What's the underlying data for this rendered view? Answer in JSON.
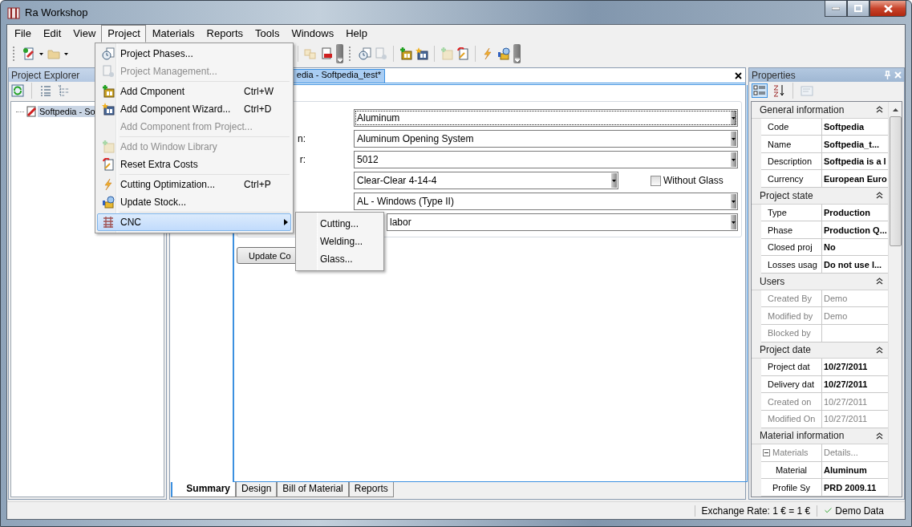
{
  "window": {
    "title": "Ra Workshop"
  },
  "menu_bar": [
    {
      "label": "File",
      "selected": false
    },
    {
      "label": "Edit",
      "selected": false
    },
    {
      "label": "View",
      "selected": false
    },
    {
      "label": "Project",
      "selected": true
    },
    {
      "label": "Materials",
      "selected": false
    },
    {
      "label": "Reports",
      "selected": false
    },
    {
      "label": "Tools",
      "selected": false
    },
    {
      "label": "Windows",
      "selected": false
    },
    {
      "label": "Help",
      "selected": false
    }
  ],
  "project_explorer": {
    "title": "Project Explorer",
    "tree": [
      {
        "label": "Softpedia - So",
        "selected": true
      }
    ]
  },
  "document": {
    "tab": {
      "label": "edia - Softpedia_test*",
      "selected": true
    },
    "fields": [
      {
        "value": "Aluminum",
        "focused": true,
        "short": false
      },
      {
        "label": "n:",
        "value": "Aluminum Opening System",
        "focused": false,
        "short": false
      },
      {
        "label": "r:",
        "value": "5012",
        "focused": false,
        "short": false
      },
      {
        "value": "Clear-Clear 4-14-4",
        "focused": false,
        "short": true
      },
      {
        "value": "AL - Windows (Type II)",
        "focused": false,
        "short": false
      },
      {
        "value": "labor",
        "focused": false,
        "short": false
      }
    ],
    "checkbox": {
      "label": "Without Glass",
      "checked": false
    },
    "button": "Update Co",
    "bottom_tabs": [
      {
        "label": "Summary",
        "selected": true
      },
      {
        "label": "Design",
        "selected": false
      },
      {
        "label": "Bill of Material",
        "selected": false
      },
      {
        "label": "Reports",
        "selected": false
      }
    ]
  },
  "project_menu": [
    {
      "kind": "item",
      "label": "Project Phases...",
      "disabled": false,
      "selected": false
    },
    {
      "kind": "item",
      "label": "Project Management...",
      "disabled": true,
      "selected": false
    },
    {
      "kind": "separator"
    },
    {
      "kind": "item",
      "label": "Add Cmponent",
      "shortcut": "Ctrl+W",
      "disabled": false,
      "selected": false
    },
    {
      "kind": "item",
      "label": "Add Component Wizard...",
      "shortcut": "Ctrl+D",
      "disabled": false,
      "selected": false
    },
    {
      "kind": "item",
      "label": "Add Component from Project...",
      "disabled": true,
      "selected": false
    },
    {
      "kind": "separator"
    },
    {
      "kind": "item",
      "label": "Add to Window Library",
      "disabled": true,
      "selected": false
    },
    {
      "kind": "item",
      "label": "Reset Extra Costs",
      "disabled": false,
      "selected": false
    },
    {
      "kind": "separator"
    },
    {
      "kind": "item",
      "label": "Cutting Optimization...",
      "shortcut": "Ctrl+P",
      "disabled": false,
      "selected": false
    },
    {
      "kind": "item",
      "label": "Update Stock...",
      "disabled": false,
      "selected": false
    },
    {
      "kind": "separator"
    },
    {
      "kind": "submenu",
      "label": "CNC",
      "disabled": false,
      "selected": true
    }
  ],
  "cnc_submenu": [
    "Cutting...",
    "Welding...",
    "Glass..."
  ],
  "properties": {
    "title": "Properties",
    "sections": [
      {
        "title": "General information",
        "rows": [
          {
            "name": "Code",
            "value": "Softpedia",
            "readonly": false
          },
          {
            "name": "Name",
            "value": "Softpedia_t...",
            "readonly": false
          },
          {
            "name": "Description",
            "value": "Softpedia is a l",
            "readonly": false
          },
          {
            "name": "Currency",
            "value": "European Euro",
            "readonly": false
          }
        ]
      },
      {
        "title": "Project state",
        "rows": [
          {
            "name": "Type",
            "value": "Production",
            "readonly": false
          },
          {
            "name": "Phase",
            "value": "Production Q...",
            "readonly": false
          },
          {
            "name": "Closed proj",
            "value": "No",
            "readonly": false
          },
          {
            "name": "Losses usag",
            "value": "Do not use l...",
            "readonly": false
          }
        ]
      },
      {
        "title": "Users",
        "rows": [
          {
            "name": "Created By",
            "value": "Demo",
            "readonly": true
          },
          {
            "name": "Modified by",
            "value": "Demo",
            "readonly": true
          },
          {
            "name": "Blocked by",
            "readonly": true
          }
        ]
      },
      {
        "title": "Project date",
        "rows": [
          {
            "name": "Project dat",
            "value": "10/27/2011",
            "readonly": false
          },
          {
            "name": "Delivery dat",
            "value": "10/27/2011",
            "readonly": false
          },
          {
            "name": "Created on",
            "value": "10/27/2011",
            "readonly": true
          },
          {
            "name": "Modified On",
            "value": "10/27/2011",
            "readonly": true
          }
        ]
      },
      {
        "title": "Material information",
        "rows": [
          {
            "name": "Materials",
            "value": "Details...",
            "readonly": true,
            "expanded": true,
            "children": [
              {
                "name": "Material",
                "value": "Aluminum",
                "readonly": false
              },
              {
                "name": "Profile Sy",
                "value": "PRD 2009.11",
                "readonly": false
              }
            ]
          }
        ]
      }
    ]
  },
  "status_bar": {
    "exchange_rate": "Exchange Rate: 1 € = 1 €",
    "data_mode": "Demo Data"
  }
}
